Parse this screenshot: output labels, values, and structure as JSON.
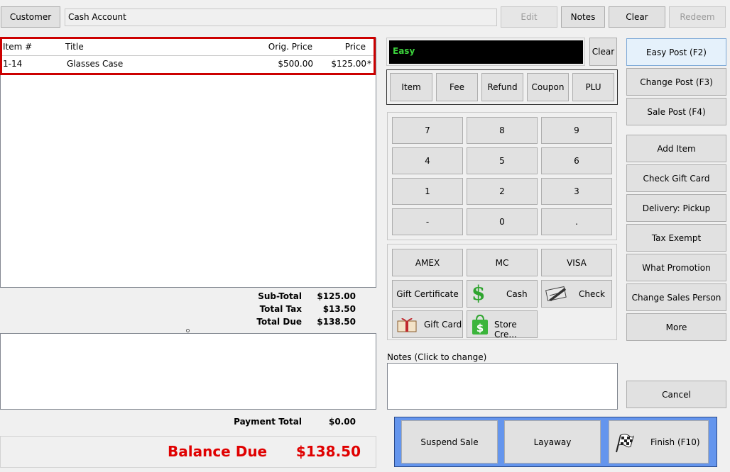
{
  "top": {
    "customer_label": "Customer",
    "customer_value": "Cash Account",
    "edit": "Edit",
    "notes": "Notes",
    "clear": "Clear",
    "redeem": "Redeem"
  },
  "items_table": {
    "columns": [
      "Item #",
      "Title",
      "Orig. Price",
      "Price"
    ],
    "rows": [
      {
        "item": "1-14",
        "title": "Glasses Case",
        "orig_price": "$500.00",
        "price": "$125.00",
        "flag": "*"
      }
    ]
  },
  "totals": {
    "subtotal_label": "Sub-Total",
    "subtotal": "$125.00",
    "tax_label": "Total Tax",
    "tax": "$13.50",
    "due_label": "Total Due",
    "due": "$138.50",
    "payment_label": "Payment Total",
    "payment": "$0.00",
    "balance_label": "Balance Due",
    "balance": "$138.50"
  },
  "entry": {
    "mode": "Easy",
    "clear": "Clear"
  },
  "entry_types": [
    "Item",
    "Fee",
    "Refund",
    "Coupon",
    "PLU"
  ],
  "keypad": [
    "7",
    "8",
    "9",
    "4",
    "5",
    "6",
    "1",
    "2",
    "3",
    "-",
    "0",
    "."
  ],
  "payments": {
    "amex": "AMEX",
    "mc": "MC",
    "visa": "VISA",
    "gift_certificate": "Gift Certificate",
    "cash": "Cash",
    "check": "Check",
    "gift_card": "Gift Card",
    "store_credit": "Store Cre..."
  },
  "notes_label": "Notes (Click to change)",
  "side_buttons": {
    "easy_post": "Easy Post (F2)",
    "change_post": "Change Post (F3)",
    "sale_post": "Sale Post (F4)",
    "add_item": "Add Item",
    "check_gift_card": "Check Gift Card",
    "delivery": "Delivery: Pickup",
    "tax_exempt": "Tax Exempt",
    "what_promotion": "What Promotion",
    "change_sales_person": "Change Sales Person",
    "more": "More",
    "cancel": "Cancel"
  },
  "bottom_actions": {
    "suspend": "Suspend Sale",
    "layaway": "Layaway",
    "finish": "Finish (F10)"
  },
  "colors": {
    "highlight_border": "#cc0000",
    "balance_red": "#e00000",
    "easy_green": "#3cd23c",
    "action_panel_blue": "#6495ed"
  }
}
